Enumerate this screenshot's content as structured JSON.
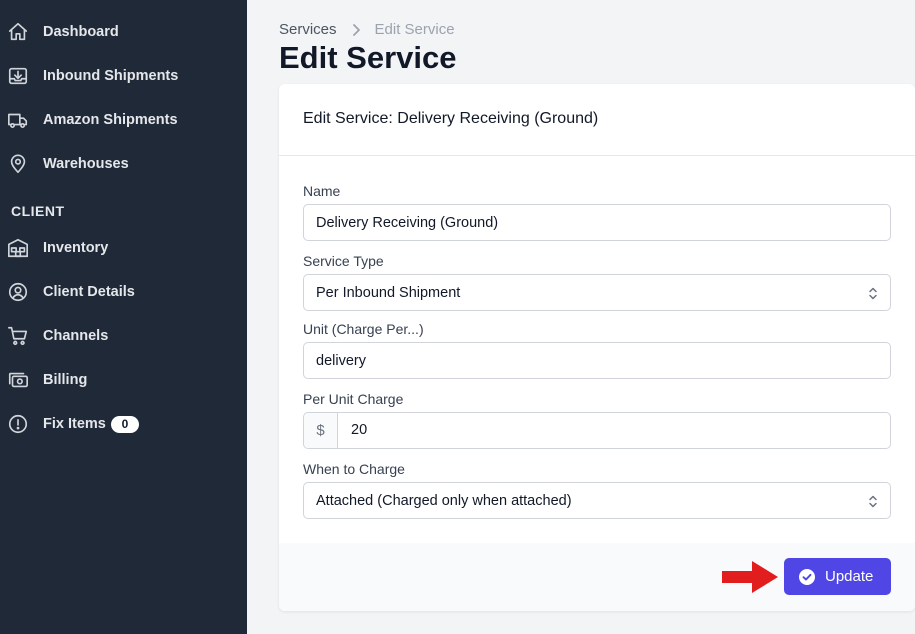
{
  "sidebar": {
    "items": [
      {
        "label": "Dashboard",
        "icon": "home-icon"
      },
      {
        "label": "Inbound Shipments",
        "icon": "inbox-in-icon"
      },
      {
        "label": "Amazon Shipments",
        "icon": "truck-icon"
      },
      {
        "label": "Warehouses",
        "icon": "location-pin-icon"
      }
    ],
    "section_title": "CLIENT",
    "client_items": [
      {
        "label": "Inventory",
        "icon": "warehouse-shelves-icon"
      },
      {
        "label": "Client Details",
        "icon": "user-circle-icon"
      },
      {
        "label": "Channels",
        "icon": "shopping-cart-icon"
      },
      {
        "label": "Billing",
        "icon": "cash-icon"
      },
      {
        "label": "Fix Items",
        "icon": "exclamation-circle-icon",
        "badge": "0"
      }
    ]
  },
  "breadcrumb": {
    "parent": "Services",
    "current": "Edit Service"
  },
  "page_title": "Edit Service",
  "card": {
    "title": "Edit Service: Delivery Receiving (Ground)",
    "fields": {
      "name": {
        "label": "Name",
        "value": "Delivery Receiving (Ground)"
      },
      "service_type": {
        "label": "Service Type",
        "value": "Per Inbound Shipment"
      },
      "unit": {
        "label": "Unit (Charge Per...)",
        "value": "delivery"
      },
      "per_unit_charge": {
        "label": "Per Unit Charge",
        "prefix": "$",
        "value": "20"
      },
      "when_to_charge": {
        "label": "When to Charge",
        "value": "Attached (Charged only when attached)"
      }
    },
    "update_label": "Update"
  },
  "colors": {
    "sidebar_bg": "#1f2937",
    "primary": "#5046e5",
    "arrow": "#e11d1d"
  }
}
